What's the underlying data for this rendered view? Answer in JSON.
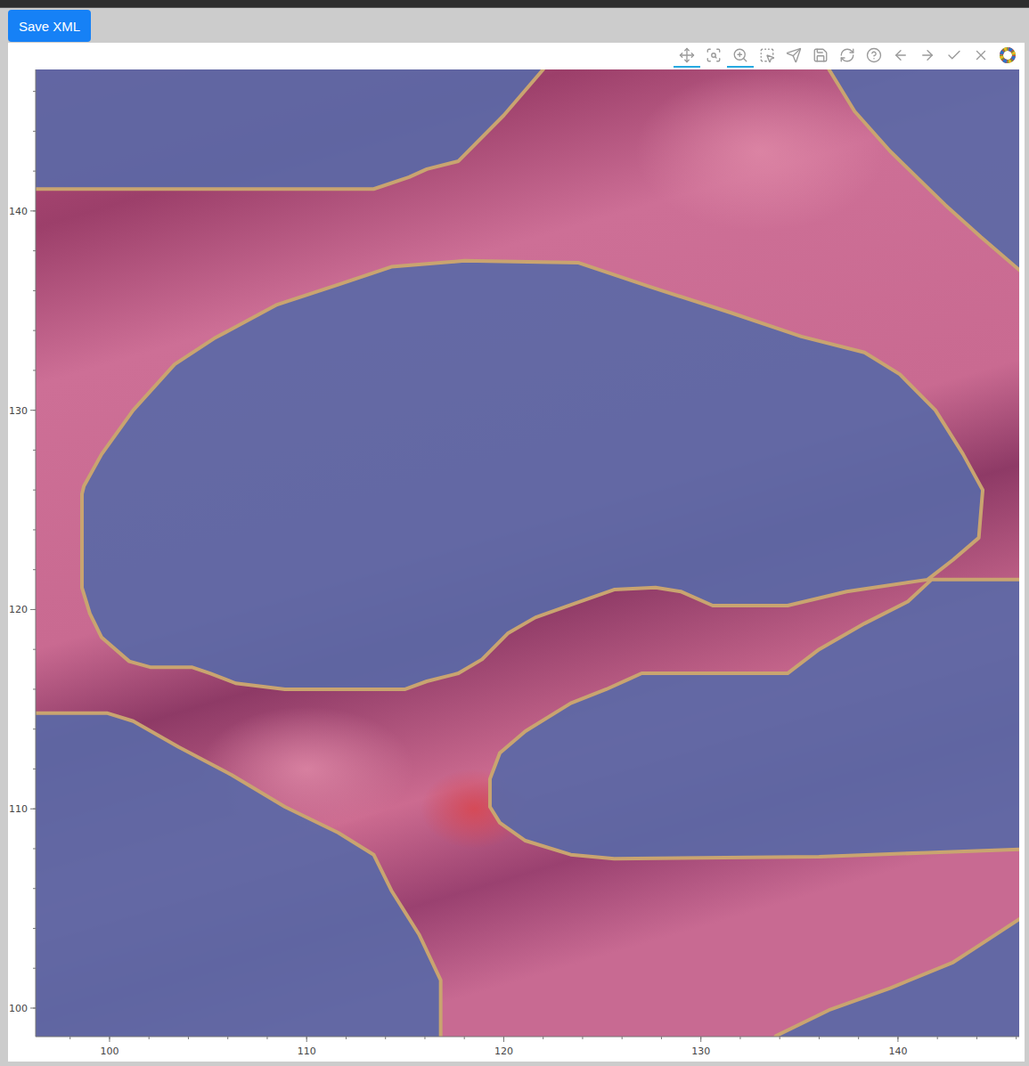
{
  "header": {
    "save_button": "Save XML"
  },
  "toolbar": {
    "tools": [
      {
        "kind": "pan",
        "selected": true
      },
      {
        "kind": "box-zoom",
        "selected": false
      },
      {
        "kind": "wheel-zoom",
        "selected": true
      },
      {
        "kind": "box-edit",
        "selected": false
      },
      {
        "kind": "poly-draw",
        "selected": false
      },
      {
        "kind": "save",
        "selected": false
      },
      {
        "kind": "reset",
        "selected": false
      },
      {
        "kind": "help",
        "selected": false
      },
      {
        "kind": "undo",
        "selected": false
      },
      {
        "kind": "redo",
        "selected": false
      },
      {
        "kind": "accept",
        "selected": false
      },
      {
        "kind": "reject",
        "selected": false
      },
      {
        "kind": "logo",
        "selected": false
      }
    ]
  },
  "plot": {
    "x_axis": {
      "range": [
        96.25,
        146.15
      ],
      "ticks": [
        "100",
        "110",
        "120",
        "130",
        "140"
      ]
    },
    "y_axis": {
      "range": [
        98.57,
        147.1
      ],
      "ticks": [
        "100",
        "110",
        "120",
        "130",
        "140"
      ]
    },
    "annotations": [
      {
        "points": [
          [
            98.6,
            125.8
          ],
          [
            98.6,
            121.1
          ],
          [
            99.0,
            119.8
          ],
          [
            99.6,
            118.6
          ],
          [
            101.0,
            117.4
          ],
          [
            102.1,
            117.1
          ],
          [
            104.2,
            117.1
          ],
          [
            105.1,
            116.8
          ],
          [
            106.4,
            116.3
          ],
          [
            108.9,
            116.0
          ],
          [
            115.0,
            116.0
          ],
          [
            116.1,
            116.4
          ],
          [
            117.7,
            116.8
          ],
          [
            118.9,
            117.5
          ],
          [
            120.2,
            118.8
          ],
          [
            121.6,
            119.6
          ],
          [
            123.6,
            120.3
          ],
          [
            125.6,
            121.0
          ],
          [
            127.7,
            121.1
          ],
          [
            129.0,
            120.9
          ],
          [
            130.6,
            120.2
          ],
          [
            134.4,
            120.2
          ],
          [
            137.4,
            120.9
          ],
          [
            141.5,
            121.5
          ],
          [
            142.8,
            122.5
          ],
          [
            144.1,
            123.6
          ],
          [
            144.3,
            126.0
          ],
          [
            143.3,
            127.8
          ],
          [
            141.9,
            130.0
          ],
          [
            140.1,
            131.8
          ],
          [
            138.3,
            132.9
          ],
          [
            135.1,
            133.7
          ],
          [
            131.5,
            134.9
          ],
          [
            127.4,
            136.2
          ],
          [
            123.8,
            137.4
          ],
          [
            118.0,
            137.5
          ],
          [
            114.3,
            137.2
          ],
          [
            111.6,
            136.3
          ],
          [
            108.5,
            135.3
          ],
          [
            105.3,
            133.6
          ],
          [
            103.3,
            132.3
          ],
          [
            101.2,
            130.0
          ],
          [
            99.6,
            127.8
          ],
          [
            98.7,
            126.2
          ]
        ]
      },
      {
        "points": [
          [
            95,
            148
          ],
          [
            122.4,
            148
          ],
          [
            122.0,
            147.1
          ],
          [
            120.0,
            144.8
          ],
          [
            117.7,
            142.5
          ],
          [
            116.1,
            142.1
          ],
          [
            115.2,
            141.7
          ],
          [
            113.4,
            141.1
          ],
          [
            95,
            141.1
          ]
        ]
      },
      {
        "points": [
          [
            136.5,
            148
          ],
          [
            136.5,
            147.1
          ],
          [
            137.8,
            145.0
          ],
          [
            139.6,
            143.0
          ],
          [
            142.4,
            140.3
          ],
          [
            144.2,
            138.7
          ],
          [
            146.2,
            137.0
          ],
          [
            147,
            136.5
          ],
          [
            147,
            148
          ]
        ]
      },
      {
        "points": [
          [
            127.0,
            116.8
          ],
          [
            134.4,
            116.8
          ],
          [
            136.0,
            118.0
          ],
          [
            138.3,
            119.3
          ],
          [
            140.5,
            120.4
          ],
          [
            141.7,
            121.5
          ],
          [
            147,
            121.5
          ],
          [
            147,
            108.0
          ],
          [
            141.5,
            107.8
          ],
          [
            136.0,
            107.6
          ],
          [
            125.6,
            107.5
          ],
          [
            123.4,
            107.7
          ],
          [
            121.1,
            108.4
          ],
          [
            119.8,
            109.3
          ],
          [
            119.3,
            110.1
          ],
          [
            119.3,
            111.5
          ],
          [
            119.8,
            112.8
          ],
          [
            121.1,
            113.9
          ],
          [
            123.4,
            115.3
          ],
          [
            125.2,
            116.0
          ]
        ]
      },
      {
        "points": [
          [
            95,
            114.8
          ],
          [
            99.9,
            114.8
          ],
          [
            101.2,
            114.4
          ],
          [
            103.5,
            113.1
          ],
          [
            106.2,
            111.7
          ],
          [
            108.9,
            110.1
          ],
          [
            111.6,
            108.8
          ],
          [
            113.4,
            107.7
          ],
          [
            114.3,
            105.9
          ],
          [
            115.7,
            103.7
          ],
          [
            116.8,
            101.4
          ],
          [
            116.8,
            98.0
          ],
          [
            95,
            98.0
          ]
        ]
      },
      {
        "points": [
          [
            147,
            104.0
          ],
          [
            146.2,
            104.5
          ],
          [
            144.2,
            103.2
          ],
          [
            142.8,
            102.3
          ],
          [
            139.6,
            101.0
          ],
          [
            136.5,
            99.9
          ],
          [
            133.8,
            98.6
          ],
          [
            133.5,
            98.0
          ],
          [
            147,
            98.0
          ]
        ]
      }
    ]
  }
}
